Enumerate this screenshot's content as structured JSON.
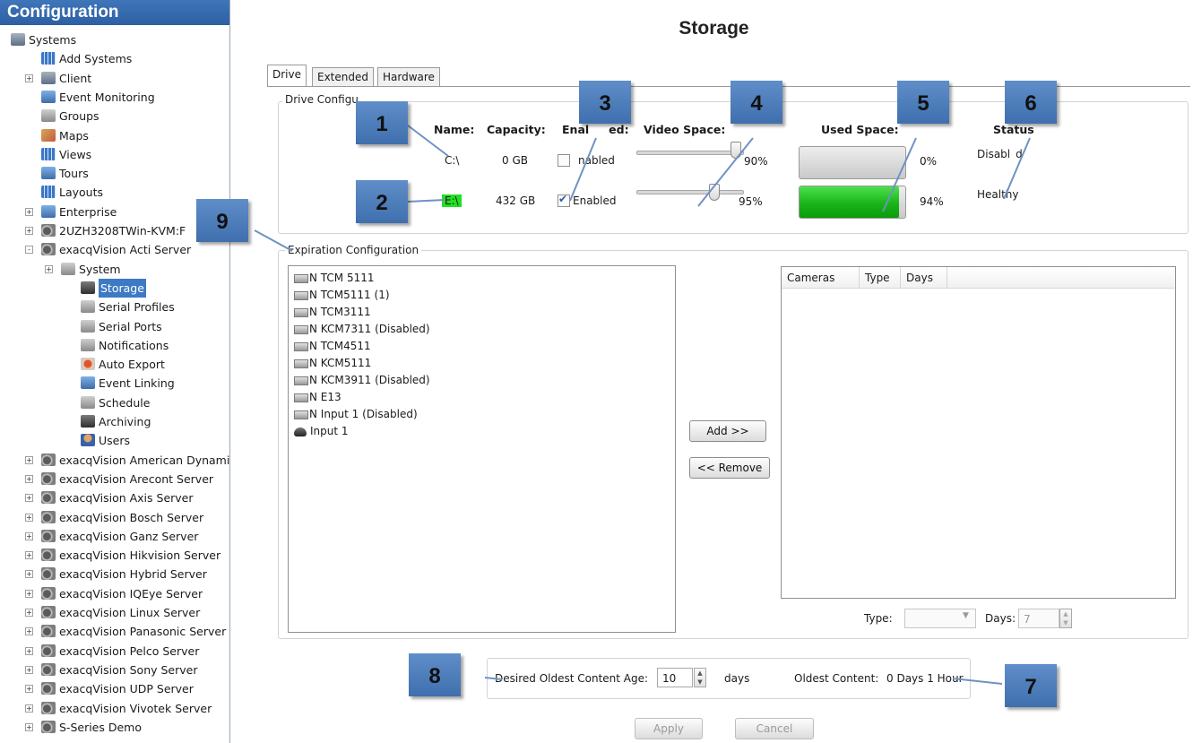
{
  "left_panel": {
    "title": "Configuration",
    "tree": [
      {
        "label": "Systems"
      },
      {
        "label": "Add Systems"
      },
      {
        "label": "Client"
      },
      {
        "label": "Event Monitoring"
      },
      {
        "label": "Groups"
      },
      {
        "label": "Maps"
      },
      {
        "label": "Views"
      },
      {
        "label": "Tours"
      },
      {
        "label": "Layouts"
      },
      {
        "label": "Enterprise"
      },
      {
        "label": "2UZH3208TWin-KVM:F"
      },
      {
        "label": "exacqVision Acti Server"
      },
      {
        "label": "System"
      },
      {
        "label": "Storage",
        "selected": true
      },
      {
        "label": "Serial Profiles"
      },
      {
        "label": "Serial Ports"
      },
      {
        "label": "Notifications"
      },
      {
        "label": "Auto Export"
      },
      {
        "label": "Event Linking"
      },
      {
        "label": "Schedule"
      },
      {
        "label": "Archiving"
      },
      {
        "label": "Users"
      },
      {
        "label": "exacqVision American Dynami"
      },
      {
        "label": "exacqVision Arecont Server"
      },
      {
        "label": "exacqVision Axis Server"
      },
      {
        "label": "exacqVision Bosch Server"
      },
      {
        "label": "exacqVision Ganz Server"
      },
      {
        "label": "exacqVision Hikvision Server"
      },
      {
        "label": "exacqVision Hybrid Server"
      },
      {
        "label": "exacqVision IQEye Server"
      },
      {
        "label": "exacqVision Linux Server"
      },
      {
        "label": "exacqVision Panasonic Server"
      },
      {
        "label": "exacqVision Pelco Server"
      },
      {
        "label": "exacqVision Sony Server"
      },
      {
        "label": "exacqVision UDP Server"
      },
      {
        "label": "exacqVision Vivotek Server"
      },
      {
        "label": "S-Series Demo"
      }
    ]
  },
  "main": {
    "title": "Storage",
    "tabs": [
      {
        "label": "Drive",
        "active": true
      },
      {
        "label": "Extended"
      },
      {
        "label": "Hardware"
      }
    ],
    "drive_config": {
      "group_label": "Drive Configu",
      "headers": {
        "name": "Name:",
        "capacity": "Capacity:",
        "enabled": "Enal",
        "enabled_tail": "ed:",
        "video_space": "Video Space:",
        "used_space": "Used Space:",
        "status": "Status"
      },
      "drives": [
        {
          "name": "C:\\",
          "capacity": "0 GB",
          "enabled": false,
          "enabled_label": "nabled",
          "video_space_pct": "90%",
          "video_space_value": 0.9,
          "used_space_pct": "0%",
          "used_space_value": 0,
          "status": "Disabl",
          "status_tail": "d"
        },
        {
          "name": "E:\\",
          "capacity": "432 GB",
          "enabled": true,
          "enabled_label": "Enabled",
          "video_space_pct": "95%",
          "video_space_value": 0.95,
          "used_space_pct": "94%",
          "used_space_value": 0.94,
          "status": "Healthy"
        }
      ]
    },
    "expiration": {
      "group_label": "Expiration Configuration",
      "cameras": [
        {
          "label": "TCM 5111"
        },
        {
          "label": "TCM5111 (1)"
        },
        {
          "label": "TCM3111"
        },
        {
          "label": "KCM7311 (Disabled)"
        },
        {
          "label": "TCM4511"
        },
        {
          "label": "KCM5111"
        },
        {
          "label": "KCM3911 (Disabled)"
        },
        {
          "label": "E13"
        },
        {
          "label": "Input 1 (Disabled)"
        },
        {
          "label": "Input 1",
          "icon": "dome-camera-icon"
        }
      ],
      "add_label": "Add >>",
      "remove_label": "<< Remove",
      "table_columns": [
        "Cameras",
        "Type",
        "Days"
      ],
      "type_label": "Type:",
      "type_value": "",
      "days_label": "Days:",
      "days_value": "7"
    },
    "content_age": {
      "desired_label": "Desired Oldest Content Age:",
      "desired_value": "10",
      "unit": "days",
      "oldest_label": "Oldest Content:",
      "oldest_value": "0 Days 1 Hour"
    },
    "apply_label": "Apply",
    "cancel_label": "Cancel"
  },
  "callouts": [
    "1",
    "2",
    "3",
    "4",
    "5",
    "6",
    "7",
    "8",
    "9"
  ],
  "colors": {
    "title_bar": "#3a6fb3",
    "selection": "#3d7ac4",
    "callout": "#4f7fbf",
    "used_bar_green": "#19b519",
    "drive_highlight": "#20e020"
  }
}
